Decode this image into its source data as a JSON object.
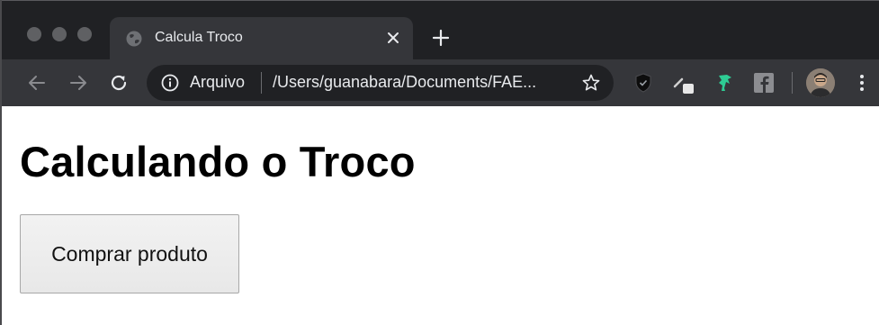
{
  "browser": {
    "tab": {
      "title": "Calcula Troco"
    },
    "omnibox": {
      "scheme_label": "Arquivo",
      "url": "/Users/guanabara/Documents/FAE..."
    },
    "icons": {
      "back": "arrow-left-icon",
      "forward": "arrow-right-icon",
      "reload": "reload-icon",
      "info": "info-icon",
      "bookmark": "star-icon",
      "menu": "kebab-icon"
    },
    "extensions": [
      "shield-extension-icon",
      "pen-extension-icon",
      "dino-extension-icon",
      "facebook-extension-icon"
    ],
    "colors": {
      "tabstrip": "#202124",
      "toolbar": "#35363a",
      "text": "#e8eaed"
    }
  },
  "page": {
    "heading": "Calculando o Troco",
    "button_label": "Comprar produto"
  }
}
